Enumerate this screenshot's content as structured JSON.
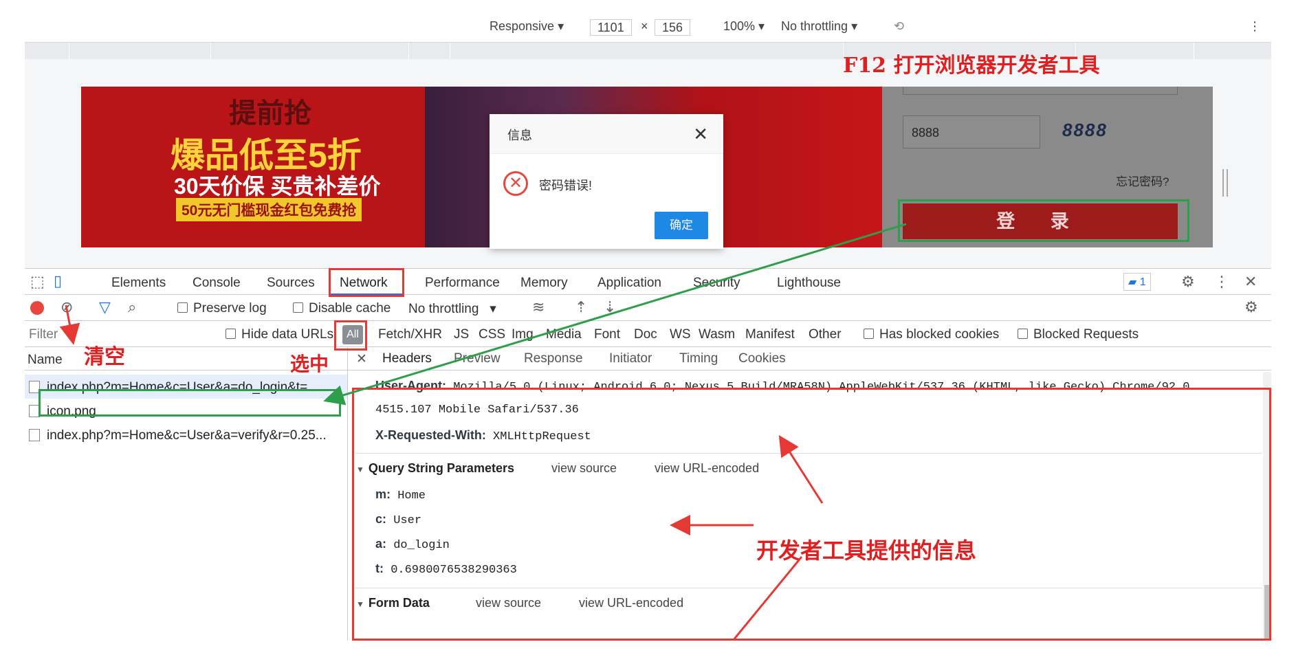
{
  "device_toolbar": {
    "mode": "Responsive",
    "width": "1101",
    "height": "156",
    "zoom": "100%",
    "throttle": "No throttling"
  },
  "page": {
    "banner_line1": "提前抢",
    "banner_line2": "爆品低至5折",
    "banner_line3": "30天价保 买贵补差价",
    "banner_line4": "50元无门槛现金红包免费抢",
    "captcha_value": "8888",
    "captcha_image_text": "8888",
    "forgot_link": "忘记密码?",
    "login_button": "登 录"
  },
  "dialog": {
    "title": "信息",
    "message": "密码错误!",
    "ok": "确定"
  },
  "devtools": {
    "tabs": [
      "Elements",
      "Console",
      "Sources",
      "Network",
      "Performance",
      "Memory",
      "Application",
      "Security",
      "Lighthouse"
    ],
    "active_tab": "Network",
    "message_count": "1",
    "toolbar": {
      "preserve_log": "Preserve log",
      "disable_cache": "Disable cache",
      "throttling": "No throttling"
    },
    "filter": {
      "placeholder": "Filter",
      "hide_data_urls": "Hide data URLs",
      "all": "All",
      "types": [
        "Fetch/XHR",
        "JS",
        "CSS",
        "Img",
        "Media",
        "Font",
        "Doc",
        "WS",
        "Wasm",
        "Manifest",
        "Other"
      ],
      "has_blocked": "Has blocked cookies",
      "blocked_requests": "Blocked Requests"
    },
    "name_header": "Name",
    "requests": [
      "index.php?m=Home&c=User&a=do_login&t=...",
      "icon.png",
      "index.php?m=Home&c=User&a=verify&r=0.25..."
    ],
    "detail_tabs": [
      "Headers",
      "Preview",
      "Response",
      "Initiator",
      "Timing",
      "Cookies"
    ],
    "headers": {
      "ua_key": "User-Agent:",
      "ua_val": "Mozilla/5.0 (Linux; Android 6.0; Nexus 5 Build/MRA58N) AppleWebKit/537.36 (KHTML, like Gecko) Chrome/92.0.",
      "ua_val2": "4515.107 Mobile Safari/537.36",
      "xrw_key": "X-Requested-With:",
      "xrw_val": "XMLHttpRequest"
    },
    "query": {
      "title": "Query String Parameters",
      "view_source": "view source",
      "view_url": "view URL-encoded",
      "params": [
        {
          "k": "m:",
          "v": "Home"
        },
        {
          "k": "c:",
          "v": "User"
        },
        {
          "k": "a:",
          "v": "do_login"
        },
        {
          "k": "t:",
          "v": "0.6980076538290363"
        }
      ]
    },
    "form": {
      "title": "Form Data",
      "view_source": "view source",
      "view_url": "view URL-encoded"
    }
  },
  "annotations": {
    "f12": "F12 打开浏览器开发者工具",
    "clear": "清空",
    "select": "选中",
    "info": "开发者工具提供的信息"
  },
  "colors": {
    "annotation_red": "#e53935",
    "annotation_green": "#2e9e4a",
    "banner_red": "#b91418",
    "devtools_blue": "#1a73e8"
  }
}
